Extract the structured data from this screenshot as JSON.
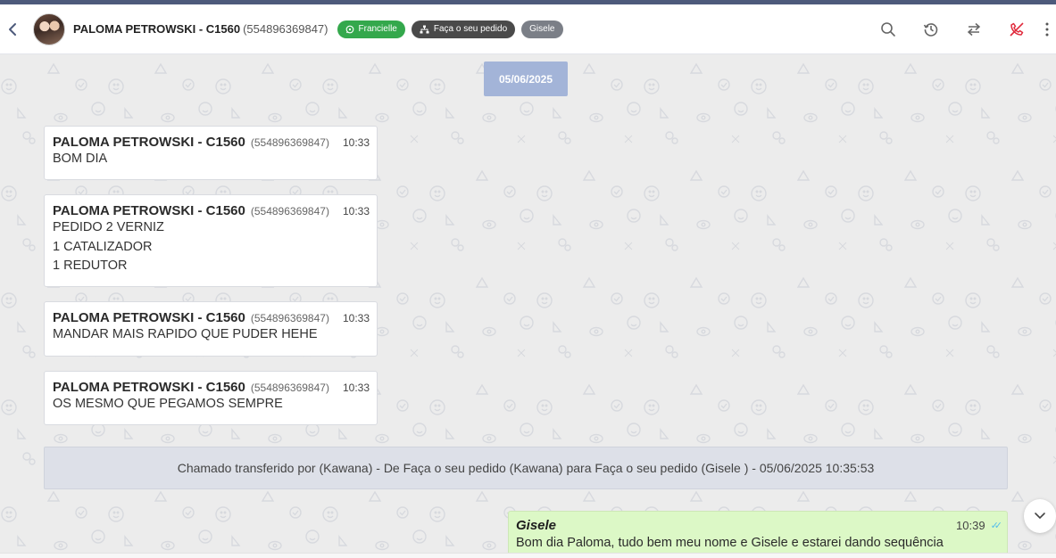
{
  "header": {
    "contact_name": "PALOMA PETROWSKI - C1560",
    "contact_phone": "(554896369847)",
    "tags": [
      {
        "label": "Francielle",
        "icon": "whatsapp-icon",
        "color": "#34a84c"
      },
      {
        "label": "Faça o seu pedido",
        "icon": "sitemap-icon",
        "color": "#4a4a4a"
      },
      {
        "label": "Gisele",
        "color": "#7b7f87"
      }
    ],
    "actions": [
      "search-icon",
      "history-icon",
      "transfer-icon",
      "end-call-icon",
      "more-icon"
    ]
  },
  "chat": {
    "date_chip": "05/06/2025",
    "messages": [
      {
        "author": "PALOMA PETROWSKI - C1560",
        "phone": "(554896369847)",
        "time": "10:33",
        "lines": [
          "BOM DIA"
        ]
      },
      {
        "author": "PALOMA PETROWSKI - C1560",
        "phone": "(554896369847)",
        "time": "10:33",
        "lines": [
          "PEDIDO 2 VERNIZ",
          "1 CATALIZADOR",
          "1 REDUTOR"
        ]
      },
      {
        "author": "PALOMA PETROWSKI - C1560",
        "phone": "(554896369847)",
        "time": "10:33",
        "lines": [
          "MANDAR MAIS RAPIDO QUE PUDER HEHE"
        ]
      },
      {
        "author": "PALOMA PETROWSKI - C1560",
        "phone": "(554896369847)",
        "time": "10:33",
        "lines": [
          "OS MESMO QUE PEGAMOS SEMPRE"
        ]
      }
    ],
    "system_message": "Chamado transferido por (Kawana) - De Faça o seu pedido (Kawana) para Faça o seu pedido (Gisele ) - 05/06/2025 10:35:53",
    "outgoing": {
      "author": "Gisele",
      "time": "10:39",
      "text": "Bom dia Paloma, tudo bem meu nome e Gisele e estarei dando sequência"
    }
  },
  "colors": {
    "accent": "#4d5a7b",
    "date_chip": "#a3b4d8",
    "outgoing_bubble": "#dcf8c6",
    "end_call": "#e02a3c"
  }
}
